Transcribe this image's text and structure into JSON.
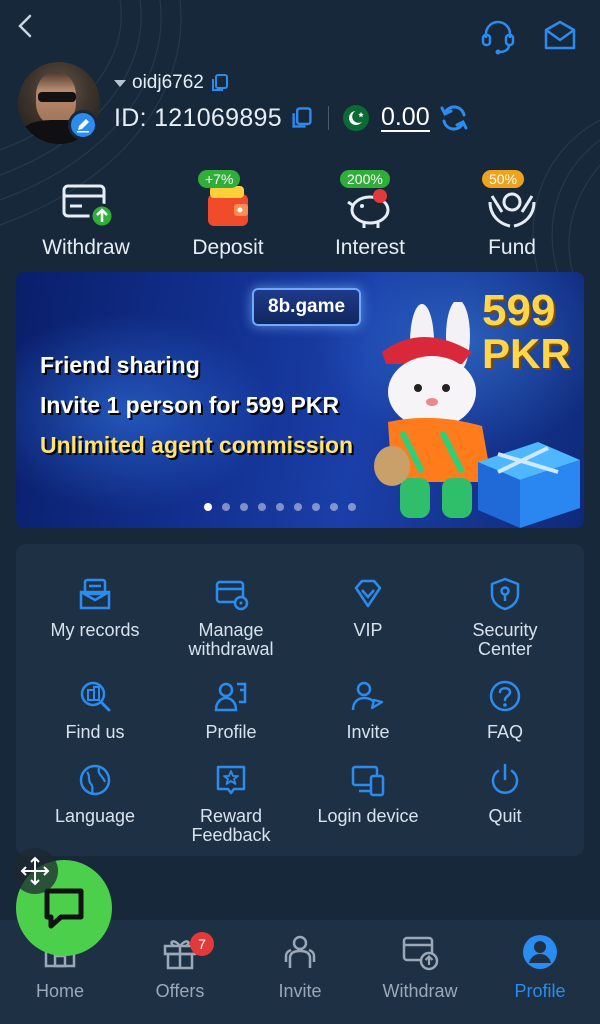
{
  "header": {
    "back_icon": "chevron-left-icon",
    "support_icon": "headset-icon",
    "mail_icon": "mail-icon"
  },
  "profile": {
    "username": "oidj6762",
    "id_label": "ID: 121069895",
    "balance": "0.00",
    "currency_flag": "pakistan-flag-icon"
  },
  "quick_actions": [
    {
      "label": "Withdraw",
      "icon": "withdraw-card-icon",
      "badge": ""
    },
    {
      "label": "Deposit",
      "icon": "wallet-icon",
      "badge": "+7%"
    },
    {
      "label": "Interest",
      "icon": "piggy-bank-icon",
      "badge": "200%"
    },
    {
      "label": "Fund",
      "icon": "hands-coin-icon",
      "badge": "50%"
    }
  ],
  "banner": {
    "brand": "8b.game",
    "amount": "599",
    "unit": "PKR",
    "line1": "Friend sharing",
    "line2": "Invite 1 person for 599 PKR",
    "line3": "Unlimited agent commission",
    "active_slide": 1,
    "slide_count": 9
  },
  "menu": [
    {
      "label": "My records",
      "icon": "records-icon"
    },
    {
      "label": "Manage withdrawal",
      "icon": "card-settings-icon"
    },
    {
      "label": "VIP",
      "icon": "diamond-icon"
    },
    {
      "label": "Security Center",
      "icon": "shield-icon"
    },
    {
      "label": "Find us",
      "icon": "search-building-icon"
    },
    {
      "label": "Profile",
      "icon": "id-card-icon"
    },
    {
      "label": "Invite",
      "icon": "user-share-icon"
    },
    {
      "label": "FAQ",
      "icon": "question-icon"
    },
    {
      "label": "Language",
      "icon": "globe-icon"
    },
    {
      "label": "Reward Feedback",
      "icon": "star-message-icon"
    },
    {
      "label": "Login device",
      "icon": "devices-icon"
    },
    {
      "label": "Quit",
      "icon": "power-icon"
    }
  ],
  "bottom_nav": [
    {
      "label": "Home",
      "icon": "home-icon"
    },
    {
      "label": "Offers",
      "icon": "gift-icon",
      "badge": "7"
    },
    {
      "label": "Invite",
      "icon": "people-icon"
    },
    {
      "label": "Withdraw",
      "icon": "card-upload-icon"
    },
    {
      "label": "Profile",
      "icon": "user-circle-icon",
      "active": true
    }
  ],
  "colors": {
    "accent": "#2a8cf0",
    "background": "#17283a",
    "card": "#1e3144",
    "chat_button": "#4cd04c"
  }
}
